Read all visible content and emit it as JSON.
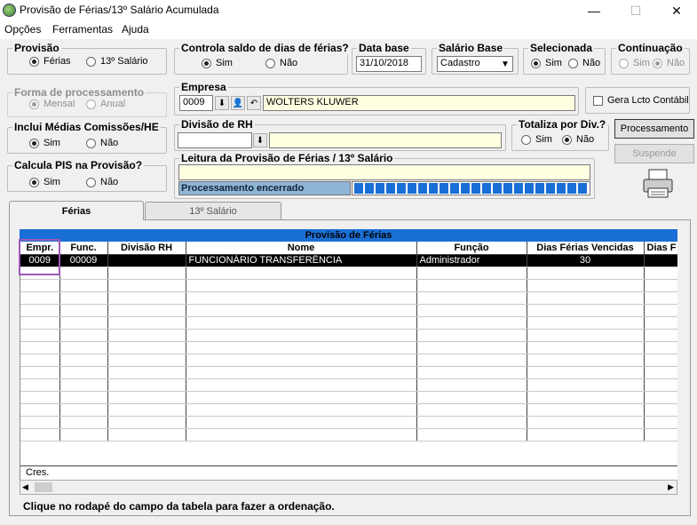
{
  "window": {
    "title": "Provisão de Férias/13º Salário Acumulada",
    "minimize": "—",
    "maximize": "☐",
    "close": "✕"
  },
  "menu": [
    "Opções",
    "Ferramentas",
    "Ajuda"
  ],
  "provisao": {
    "label": "Provisão",
    "opt1": "Férias",
    "opt2": "13º Salário"
  },
  "controla": {
    "label": "Controla saldo de dias de férias?",
    "opt1": "Sim",
    "opt2": "Não"
  },
  "data_base": {
    "label": "Data base",
    "value": "31/10/2018"
  },
  "salario_base": {
    "label": "Salário Base",
    "value": "Cadastro"
  },
  "selecionada": {
    "label": "Selecionada",
    "opt1": "Sim",
    "opt2": "Não"
  },
  "continuacao": {
    "label": "Continuação",
    "opt1": "Sim",
    "opt2": "Não"
  },
  "forma": {
    "label": "Forma de processamento",
    "opt1": "Mensal",
    "opt2": "Anual"
  },
  "empresa": {
    "label": "Empresa",
    "code": "0009",
    "name": "WOLTERS KLUWER"
  },
  "gera": {
    "label": "Gera Lcto Contábil"
  },
  "inclui": {
    "label": "Inclui Médias Comissões/HE",
    "opt1": "Sim",
    "opt2": "Não"
  },
  "divisao": {
    "label": "Divisão de RH",
    "code": "",
    "name": ""
  },
  "totaliza": {
    "label": "Totaliza por Div.?",
    "opt1": "Sim",
    "opt2": "Não"
  },
  "buttons": {
    "processamento": "Processamento",
    "suspende": "Suspende"
  },
  "calcula": {
    "label": "Calcula PIS na Provisão?",
    "opt1": "Sim",
    "opt2": "Não"
  },
  "leitura": {
    "label": "Leitura da Provisão de Férias / 13º Salário",
    "status": "Processamento encerrado"
  },
  "tabs": [
    "Férias",
    "13º Salário"
  ],
  "grid": {
    "title": "Provisão de Férias",
    "columns": [
      "Empr.",
      "Func.",
      "Divisão RH",
      "Nome",
      "Função",
      "Dias Férias Vencidas",
      "Dias F"
    ],
    "rows": [
      [
        "0009",
        "00009",
        "",
        "FUNCIONÁRIO TRANSFERÊNCIA",
        "Administrador",
        "30",
        ""
      ]
    ],
    "footer": "Cres."
  },
  "hint": "Clique no rodapé do campo da tabela  para fazer a ordenação.",
  "colors": {
    "accent": "#1a6fd6",
    "highlight": "#9b59b6",
    "field_bg": "#ffffe1"
  }
}
